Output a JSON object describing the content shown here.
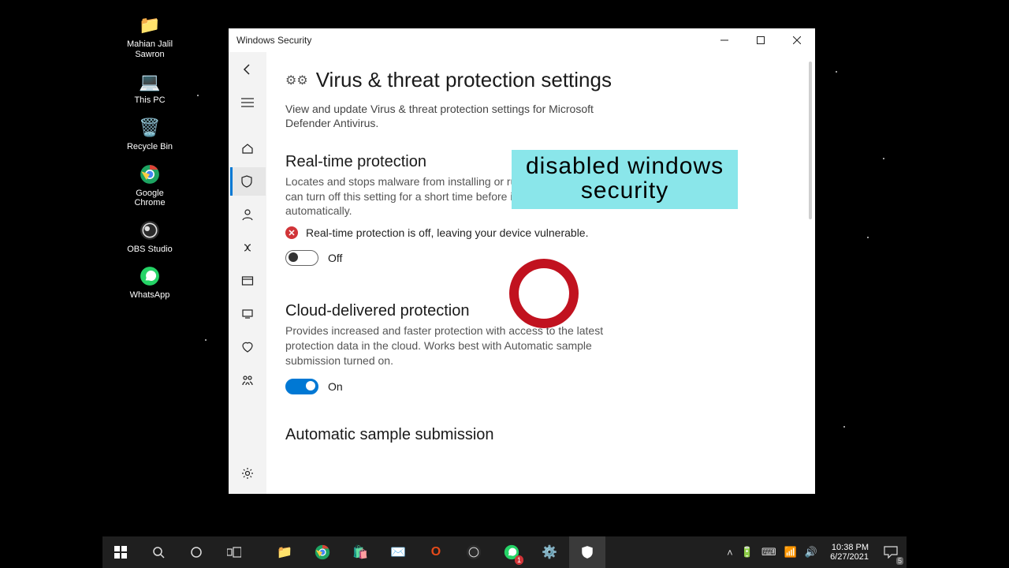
{
  "desktop_icons": [
    {
      "name": "user-folder",
      "label": "Mahian Jalil\nSawron",
      "glyph": "📁"
    },
    {
      "name": "this-pc",
      "label": "This PC",
      "glyph": "💻"
    },
    {
      "name": "recycle-bin",
      "label": "Recycle Bin",
      "glyph": "🗑️"
    },
    {
      "name": "google-chrome",
      "label": "Google\nChrome",
      "glyph": "🌐"
    },
    {
      "name": "obs-studio",
      "label": "OBS Studio",
      "glyph": "🎥"
    },
    {
      "name": "whatsapp",
      "label": "WhatsApp",
      "glyph": "💬"
    }
  ],
  "window": {
    "title": "Windows Security",
    "page_title": "Virus & threat protection settings",
    "page_desc": "View and update Virus & threat protection settings for Microsoft Defender Antivirus.",
    "sections": {
      "realtime": {
        "heading": "Real-time protection",
        "desc": "Locates and stops malware from installing or running on your device. You can turn off this setting for a short time before it turns back on automatically.",
        "warning": "Real-time protection is off, leaving your device vulnerable.",
        "toggle_state": "Off"
      },
      "cloud": {
        "heading": "Cloud-delivered protection",
        "desc": "Provides increased and faster protection with access to the latest protection data in the cloud. Works best with Automatic sample submission turned on.",
        "toggle_state": "On"
      },
      "autosample": {
        "heading": "Automatic sample submission"
      }
    }
  },
  "banner": {
    "line1": "disabled windows",
    "line2": "security"
  },
  "taskbar": {
    "whatsapp_badge": "1",
    "time": "10:38 PM",
    "date": "6/27/2021",
    "notif_count": "5"
  }
}
